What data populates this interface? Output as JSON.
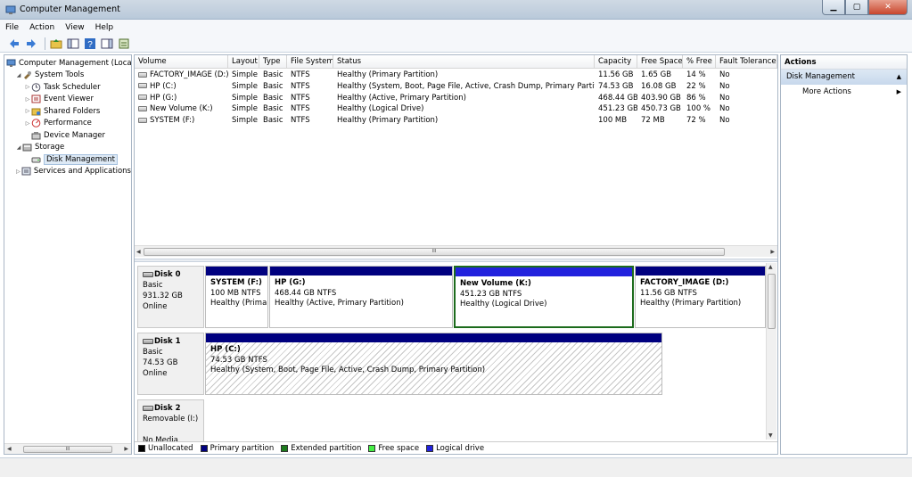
{
  "window": {
    "title": "Computer Management"
  },
  "menu": [
    "File",
    "Action",
    "View",
    "Help"
  ],
  "tree": [
    {
      "label": "Computer Management (Local",
      "depth": 0,
      "expander": "",
      "icon": "computer-management-icon"
    },
    {
      "label": "System Tools",
      "depth": 1,
      "expander": "◢",
      "icon": "tools-icon"
    },
    {
      "label": "Task Scheduler",
      "depth": 2,
      "expander": "▷",
      "icon": "clock-icon"
    },
    {
      "label": "Event Viewer",
      "depth": 2,
      "expander": "▷",
      "icon": "event-viewer-icon"
    },
    {
      "label": "Shared Folders",
      "depth": 2,
      "expander": "▷",
      "icon": "shared-folder-icon"
    },
    {
      "label": "Performance",
      "depth": 2,
      "expander": "▷",
      "icon": "performance-icon"
    },
    {
      "label": "Device Manager",
      "depth": 2,
      "expander": "",
      "icon": "device-manager-icon"
    },
    {
      "label": "Storage",
      "depth": 1,
      "expander": "◢",
      "icon": "storage-icon"
    },
    {
      "label": "Disk Management",
      "depth": 2,
      "expander": "",
      "icon": "disk-management-icon",
      "selected": true
    },
    {
      "label": "Services and Applications",
      "depth": 1,
      "expander": "▷",
      "icon": "services-icon"
    }
  ],
  "volumes": {
    "columns": [
      "Volume",
      "Layout",
      "Type",
      "File System",
      "Status",
      "Capacity",
      "Free Space",
      "% Free",
      "Fault Tolerance"
    ],
    "rows": [
      [
        "FACTORY_IMAGE (D:)",
        "Simple",
        "Basic",
        "NTFS",
        "Healthy (Primary Partition)",
        "11.56 GB",
        "1.65 GB",
        "14 %",
        "No"
      ],
      [
        "HP (C:)",
        "Simple",
        "Basic",
        "NTFS",
        "Healthy (System, Boot, Page File, Active, Crash Dump, Primary Partition)",
        "74.53 GB",
        "16.08 GB",
        "22 %",
        "No"
      ],
      [
        "HP (G:)",
        "Simple",
        "Basic",
        "NTFS",
        "Healthy (Active, Primary Partition)",
        "468.44 GB",
        "403.90 GB",
        "86 %",
        "No"
      ],
      [
        "New Volume (K:)",
        "Simple",
        "Basic",
        "NTFS",
        "Healthy (Logical Drive)",
        "451.23 GB",
        "450.73 GB",
        "100 %",
        "No"
      ],
      [
        "SYSTEM (F:)",
        "Simple",
        "Basic",
        "NTFS",
        "Healthy (Primary Partition)",
        "100 MB",
        "72 MB",
        "72 %",
        "No"
      ]
    ]
  },
  "disks": [
    {
      "name": "Disk 0",
      "type": "Basic",
      "size": "931.32 GB",
      "state": "Online",
      "partitions": [
        {
          "name": "SYSTEM  (F:)",
          "info": "100 MB NTFS",
          "status": "Healthy (Prima",
          "kind": "primary"
        },
        {
          "name": "HP  (G:)",
          "info": "468.44 GB NTFS",
          "status": "Healthy (Active, Primary Partition)",
          "kind": "primary"
        },
        {
          "name": "New Volume  (K:)",
          "info": "451.23 GB NTFS",
          "status": "Healthy (Logical Drive)",
          "kind": "logical",
          "selected": true
        },
        {
          "name": "FACTORY_IMAGE  (D:)",
          "info": "11.56 GB NTFS",
          "status": "Healthy (Primary Partition)",
          "kind": "primary"
        }
      ]
    },
    {
      "name": "Disk 1",
      "type": "Basic",
      "size": "74.53 GB",
      "state": "Online",
      "partitions": [
        {
          "name": "HP  (C:)",
          "info": "74.53 GB NTFS",
          "status": "Healthy (System, Boot, Page File, Active, Crash Dump, Primary Partition)",
          "kind": "primary",
          "hatched": true
        }
      ]
    },
    {
      "name": "Disk 2",
      "type": "Removable (I:)",
      "size": "",
      "state": "No Media",
      "partitions": []
    }
  ],
  "legend": [
    {
      "label": "Unallocated",
      "color": "#000000"
    },
    {
      "label": "Primary partition",
      "color": "#00007f"
    },
    {
      "label": "Extended partition",
      "color": "#1c7a1c"
    },
    {
      "label": "Free space",
      "color": "#44ee44"
    },
    {
      "label": "Logical drive",
      "color": "#2222dd"
    }
  ],
  "actions": {
    "header": "Actions",
    "section": "Disk Management",
    "items": [
      "More Actions"
    ]
  },
  "scroll_glyph": "III"
}
